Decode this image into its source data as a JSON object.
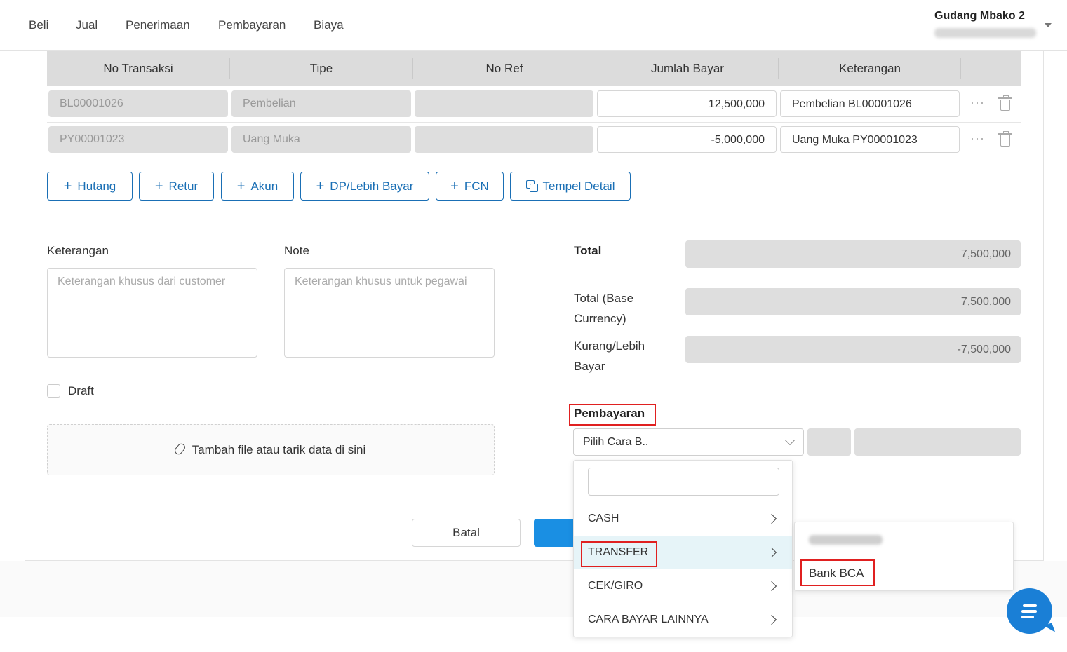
{
  "nav": {
    "items": [
      "Beli",
      "Jual",
      "Penerimaan",
      "Pembayaran",
      "Biaya"
    ],
    "company": "Gudang Mbako 2"
  },
  "table": {
    "headers": [
      "No Transaksi",
      "Tipe",
      "No Ref",
      "Jumlah Bayar",
      "Keterangan"
    ],
    "rows": [
      {
        "no_transaksi": "BL00001026",
        "tipe": "Pembelian",
        "no_ref": "",
        "jumlah": "12,500,000",
        "keterangan": "Pembelian BL00001026"
      },
      {
        "no_transaksi": "PY00001023",
        "tipe": "Uang Muka",
        "no_ref": "",
        "jumlah": "-5,000,000",
        "keterangan": "Uang Muka PY00001023"
      }
    ],
    "more_glyph": "···"
  },
  "actions": {
    "hutang": "Hutang",
    "retur": "Retur",
    "akun": "Akun",
    "dp": "DP/Lebih Bayar",
    "fcn": "FCN",
    "tempel": "Tempel Detail"
  },
  "form": {
    "keterangan_label": "Keterangan",
    "keterangan_placeholder": "Keterangan khusus dari customer",
    "note_label": "Note",
    "note_placeholder": "Keterangan khusus untuk pegawai",
    "draft_label": "Draft",
    "dropzone": "Tambah file atau tarik data di sini"
  },
  "totals": {
    "total_label": "Total",
    "total_value": "7,500,000",
    "base_label": "Total (Base Currency)",
    "base_value": "7,500,000",
    "kurang_label": "Kurang/Lebih Bayar",
    "kurang_value": "-7,500,000"
  },
  "payment": {
    "title": "Pembayaran",
    "select_value": "Pilih Cara B..",
    "options": [
      "CASH",
      "TRANSFER",
      "CEK/GIRO",
      "CARA BAYAR LAINNYA"
    ],
    "active_option": "TRANSFER",
    "sub_options": [
      "Bank BCA"
    ]
  },
  "footer": {
    "batal": "Batal"
  },
  "colors": {
    "accent": "#1a6fb5",
    "highlight_red": "#e02020",
    "primary_button": "#1a8fe3"
  }
}
